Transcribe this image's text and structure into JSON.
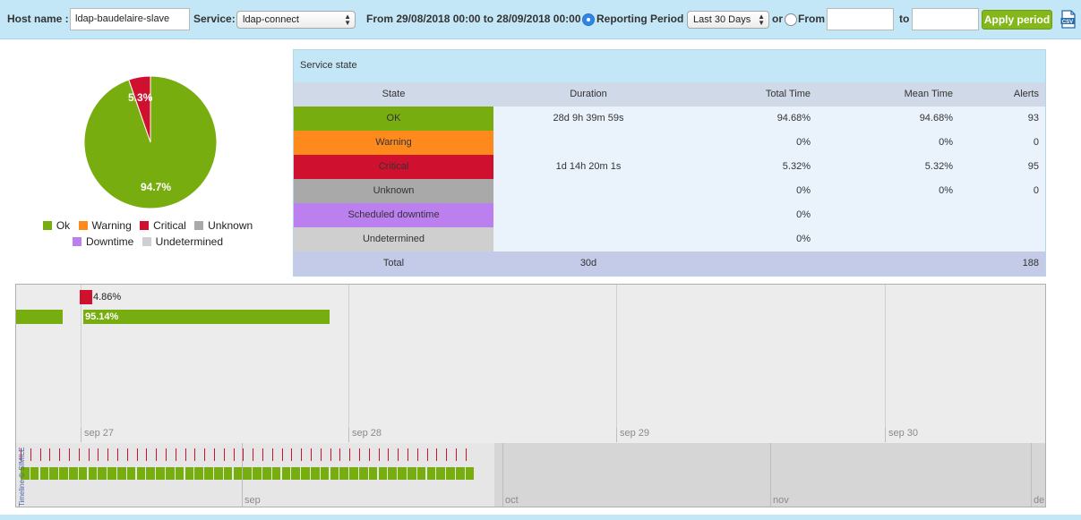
{
  "toolbar": {
    "host_label": "Host name :",
    "host_value": "ldap-baudelaire-slave",
    "service_label": "Service:",
    "service_value": "ldap-connect",
    "range_text": "From 29/08/2018 00:00 to 28/09/2018 00:00 -",
    "reporting_label": "Reporting Period :",
    "period_value": "Last 30 Days",
    "or_text": "or",
    "from_label": "From",
    "to_label": "to",
    "apply_label": "Apply period",
    "csv_icon": "csv-file-icon"
  },
  "pie": {
    "ok_label": "94.7%",
    "critical_label": "5.3%",
    "ok_fraction": 0.9468,
    "critical_fraction": 0.0532
  },
  "legend": {
    "row1": [
      {
        "label": "Ok",
        "color": "#77ad0f"
      },
      {
        "label": "Warning",
        "color": "#fe8a1d"
      },
      {
        "label": "Critical",
        "color": "#d0102f"
      },
      {
        "label": "Unknown",
        "color": "#a9a9a9"
      }
    ],
    "row2": [
      {
        "label": "Downtime",
        "color": "#bc7ff0"
      },
      {
        "label": "Undetermined",
        "color": "#cfcfcf"
      }
    ]
  },
  "service_state": {
    "title": "Service state",
    "headers": {
      "state": "State",
      "duration": "Duration",
      "total": "Total Time",
      "mean": "Mean Time",
      "alerts": "Alerts"
    },
    "rows": [
      {
        "state": "OK",
        "color": "#77ad0f",
        "duration": "28d 9h 39m 59s",
        "total": "94.68%",
        "mean": "94.68%",
        "alerts": "93"
      },
      {
        "state": "Warning",
        "color": "#fe8a1d",
        "duration": "",
        "total": "0%",
        "mean": "0%",
        "alerts": "0"
      },
      {
        "state": "Critical",
        "color": "#d0102f",
        "duration": "1d 14h 20m 1s",
        "total": "5.32%",
        "mean": "5.32%",
        "alerts": "95"
      },
      {
        "state": "Unknown",
        "color": "#a9a9a9",
        "duration": "",
        "total": "0%",
        "mean": "0%",
        "alerts": "0"
      },
      {
        "state": "Scheduled downtime",
        "color": "#bc7ff0",
        "duration": "",
        "total": "0%",
        "mean": "",
        "alerts": ""
      },
      {
        "state": "Undetermined",
        "color": "#cfcfcf",
        "duration": "",
        "total": "0%",
        "mean": "",
        "alerts": ""
      }
    ],
    "footer": {
      "label": "Total",
      "duration": "30d",
      "alerts": "188"
    }
  },
  "timeline": {
    "critical_label": "4.86%",
    "ok_label": "95.14%",
    "days": [
      "sep 27",
      "sep 28",
      "sep 29",
      "sep 30"
    ],
    "months": [
      "sep",
      "oct",
      "nov",
      "de"
    ],
    "simile_text": "Timeline © SIMILE"
  }
}
